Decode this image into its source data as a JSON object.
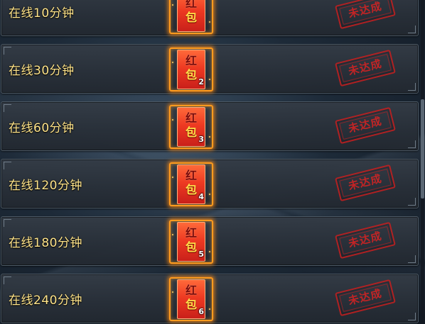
{
  "rewards": [
    {
      "label": "在线10分钟",
      "envelope_top": "红",
      "envelope_bottom": "包",
      "count": "",
      "status": "未达成"
    },
    {
      "label": "在线30分钟",
      "envelope_top": "红",
      "envelope_bottom": "包",
      "count": "2",
      "status": "未达成"
    },
    {
      "label": "在线60分钟",
      "envelope_top": "红",
      "envelope_bottom": "包",
      "count": "3",
      "status": "未达成"
    },
    {
      "label": "在线120分钟",
      "envelope_top": "红",
      "envelope_bottom": "包",
      "count": "4",
      "status": "未达成"
    },
    {
      "label": "在线180分钟",
      "envelope_top": "红",
      "envelope_bottom": "包",
      "count": "5",
      "status": "未达成"
    },
    {
      "label": "在线240分钟",
      "envelope_top": "红",
      "envelope_bottom": "包",
      "count": "6",
      "status": "未达成"
    }
  ],
  "colors": {
    "label_text": "#ffe48a",
    "envelope": "#ee3a22",
    "envelope_glow": "#ff9b1e",
    "stamp": "#d22323"
  },
  "icons": {
    "reward": "red-envelope-icon",
    "status": "not-achieved-stamp"
  }
}
